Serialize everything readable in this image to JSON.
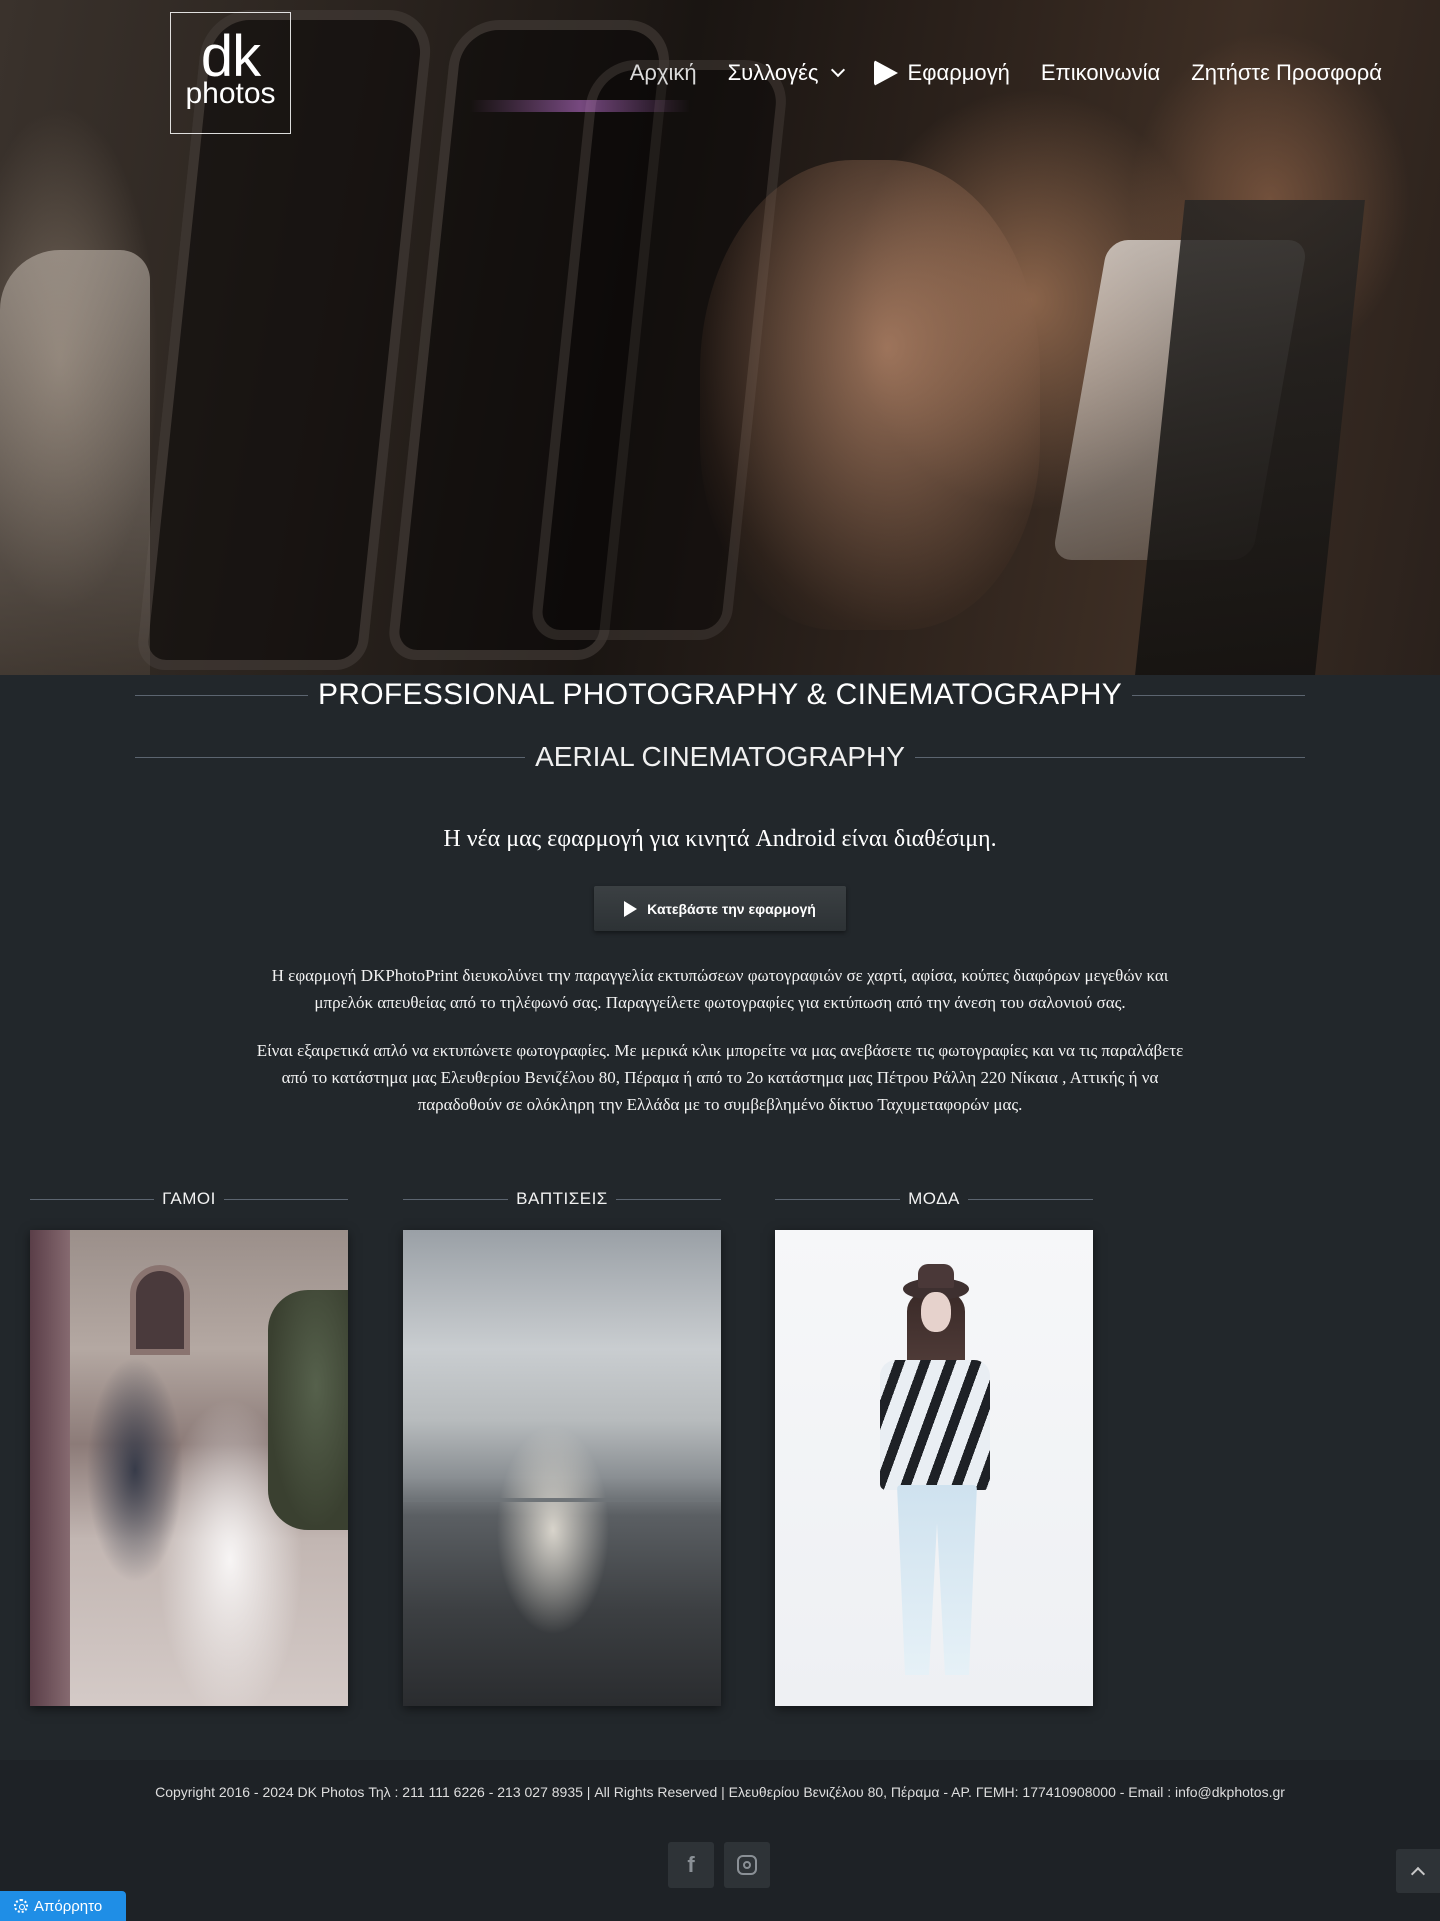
{
  "brand": {
    "logo_line1": "dk",
    "logo_line2": "photos"
  },
  "nav": {
    "items": [
      {
        "label": "Αρχική"
      },
      {
        "label": "Συλλογές"
      },
      {
        "label": "Εφαρμογή"
      },
      {
        "label": "Επικοινωνία"
      },
      {
        "label": "Ζητήστε Προσφορά"
      }
    ]
  },
  "headings": {
    "main": "PROFESSIONAL PHOTOGRAPHY & CINEMATOGRAPHY",
    "sub": "AERIAL CINEMATOGRAPHY"
  },
  "app": {
    "announcement": "Η νέα μας εφαρμογή για κινητά Android είναι διαθέσιμη.",
    "download_label": "Κατεβάστε την εφαρμογή",
    "paragraph1": "Η εφαρμογή DKPhotoPrint διευκολύνει την παραγγελία εκτυπώσεων φωτογραφιών σε χαρτί, αφίσα, κούπες διαφόρων μεγεθών και μπρελόκ απευθείας από το τηλέφωνό σας. Παραγγείλετε φωτογραφίες για εκτύπωση από την άνεση του σαλονιού σας.",
    "paragraph2": "Είναι εξαιρετικά απλό να εκτυπώνετε φωτογραφίες. Με μερικά κλικ μπορείτε να μας ανεβάσετε τις φωτογραφίες και να τις παραλάβετε από το κατάστημα μας Ελευθερίου Βενιζέλου 80, Πέραμα ή από το 2ο κατάστημα μας Πέτρου Ράλλη 220 Νίκαια , Αττικής ή να παραδοθούν σε ολόκληρη την Ελλάδα με το συμβεβλημένο δίκτυο Ταχυμεταφορών μας."
  },
  "categories": [
    {
      "label": "ΓΑΜΟΙ"
    },
    {
      "label": "ΒΑΠΤΙΣΕΙΣ"
    },
    {
      "label": "ΜΟΔΑ"
    }
  ],
  "footer": {
    "copyright": "Copyright 2016 - 2024 DK Photos  Τηλ : 211 111 6226 - 213 027 8935 |  All Rights Reserved | Ελευθερίου Βενιζέλου 80, Πέραμα - ΑΡ. ΓΕΜΗ: 177410908000 - Email : info@dkphotos.gr",
    "social": [
      "facebook-icon",
      "instagram-icon"
    ]
  },
  "privacy": {
    "label": "Απόρρητο"
  },
  "colors": {
    "page_bg": "#22272b",
    "footer_bg": "#1e2226",
    "privacy_bg": "#1f8ee6"
  }
}
